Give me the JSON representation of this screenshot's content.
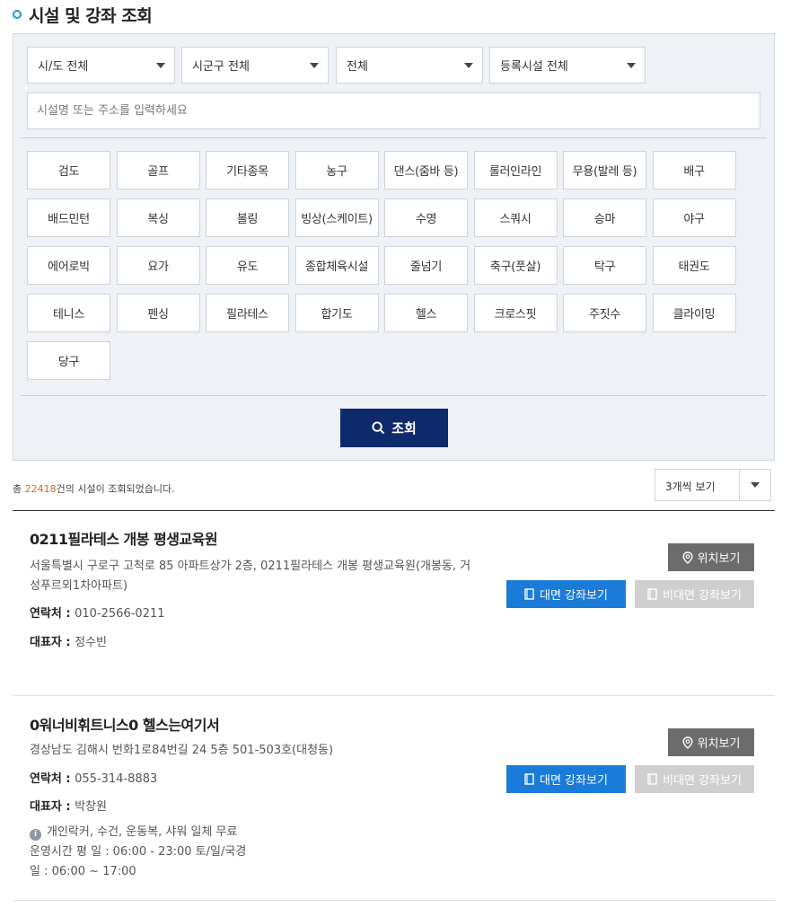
{
  "page": {
    "title": "시설 및 강좌 조회"
  },
  "filters": {
    "sido": "시/도 전체",
    "sigungu": "시군구 전체",
    "type": "전체",
    "registered": "등록시설 전체",
    "keyword_placeholder": "시설명 또는 주소를 입력하세요"
  },
  "categories": [
    "검도",
    "골프",
    "기타종목",
    "농구",
    "댄스(줌바 등)",
    "롤러인라인",
    "무용(발레 등)",
    "배구",
    "배드민턴",
    "복싱",
    "볼링",
    "빙상(스케이트)",
    "수영",
    "스쿼시",
    "승마",
    "야구",
    "에어로빅",
    "요가",
    "유도",
    "종합체육시설",
    "줄넘기",
    "축구(풋살)",
    "탁구",
    "태권도",
    "테니스",
    "펜싱",
    "필라테스",
    "합기도",
    "헬스",
    "크로스핏",
    "주짓수",
    "클라이밍",
    "당구"
  ],
  "search_button": "조회",
  "results": {
    "prefix": "총 ",
    "count": "22418",
    "suffix": "건의 시설이 조회되었습니다.",
    "per_page": "3개씩 보기"
  },
  "facilities": [
    {
      "name": "0211필라테스 개봉 평생교육원",
      "address_line1": "서울특별시 구로구 고척로 85 아파트상가 2층, 0211필라테스 개봉 평생교육원(개봉동, 거",
      "address_line2": "성푸르뫼1차아파트)",
      "contact_label": "연락처 : ",
      "contact": "010-2566-0211",
      "rep_label": "대표자 : ",
      "rep": "정수빈",
      "loc_button": "위치보기",
      "offline_button": "대면 강좌보기",
      "online_button": "비대면 강좌보기"
    },
    {
      "name": "0워너비휘트니스0 헬스는여기서",
      "address_line1": "경상남도 김해시 번화1로84번길 24 5층 501-503호(대청동)",
      "contact_label": "연락처 : ",
      "contact": "055-314-8883",
      "rep_label": "대표자 : ",
      "rep": "박창원",
      "note_line1": "개인락커, 수건, 운동복, 샤워 일체 무료",
      "note_line2": "운영시간 평 일 : 06:00 - 23:00 토/일/국경",
      "note_line3": "일 : 06:00 ~ 17:00",
      "loc_button": "위치보기",
      "offline_button": "대면 강좌보기",
      "online_button": "비대면 강좌보기"
    }
  ],
  "colors": {
    "accent": "#1ea0c8",
    "search_button": "#0f2a6b",
    "offline_button": "#1a7bd8",
    "online_button_disabled": "#cfcfcf",
    "loc_button": "#6c6c6c",
    "count_highlight": "#e2651b"
  }
}
